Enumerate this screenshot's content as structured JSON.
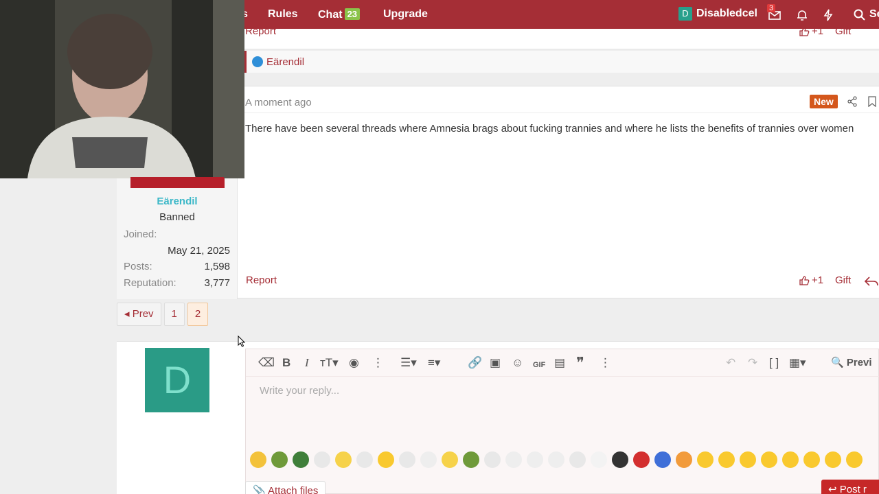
{
  "nav": {
    "partial_item": "s",
    "rules": "Rules",
    "chat": "Chat",
    "chat_count": "23",
    "upgrade": "Upgrade",
    "user_initial": "D",
    "username": "Disabledcel",
    "inbox_count": "3",
    "search_partial": "Se"
  },
  "top_post": {
    "report": "Report",
    "plus1": "+1",
    "gift": "Gift",
    "reaction_user": "Eärendil"
  },
  "post": {
    "time": "A moment ago",
    "new_badge": "New",
    "body": "There have been several threads where Amnesia brags about fucking trannies and where he lists the benefits of trannies over women",
    "report": "Report",
    "plus1": "+1",
    "gift": "Gift",
    "author": {
      "name": "Eärendil",
      "title": "Banned",
      "joined_label": "Joined:",
      "joined": "May 21, 2025",
      "posts_label": "Posts:",
      "posts": "1,598",
      "rep_label": "Reputation:",
      "rep": "3,777"
    }
  },
  "pagination": {
    "prev": "Prev",
    "pages": [
      "1",
      "2"
    ],
    "current": "2"
  },
  "reply": {
    "avatar_initial": "D",
    "placeholder": "Write your reply...",
    "preview": "Previ",
    "attach": "Attach files",
    "post": "Post r"
  },
  "colors": {
    "brand": "#a52e36",
    "new": "#d4571c",
    "chat_badge": "#8bc34a",
    "avatar": "#2a9b86"
  }
}
